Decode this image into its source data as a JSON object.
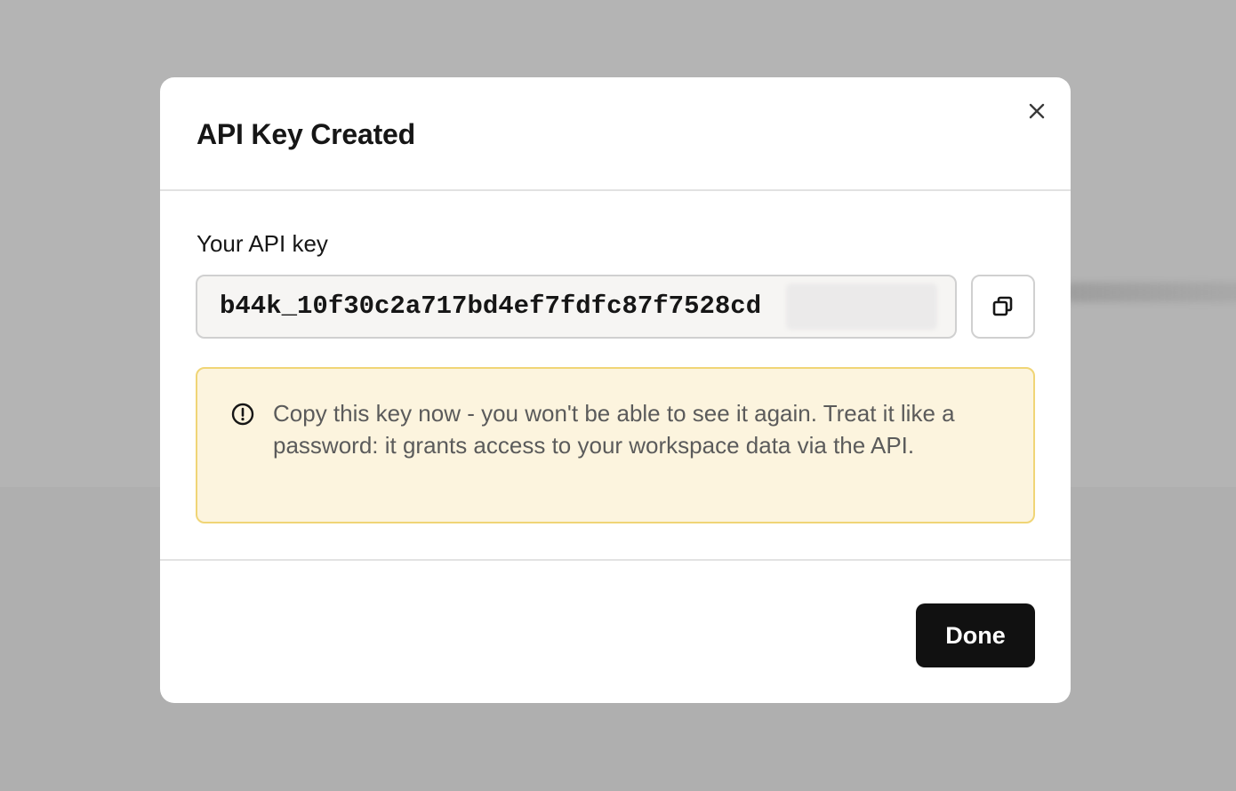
{
  "dialog": {
    "title": "API Key Created",
    "close_icon": "close-icon",
    "field_label": "Your API key",
    "api_key_visible": "b44k_10f30c2a717bd4ef7fdfc87f7528cd",
    "copy_icon": "copy-icon",
    "warning_icon": "alert-circle-icon",
    "warning_text": "Copy this key now - you won't be able to see it again. Treat it like a password: it grants access to your workspace data via the API.",
    "done_label": "Done"
  },
  "colors": {
    "backdrop": "#b4b4b4",
    "warning_bg": "#fcf4de",
    "warning_border": "#f0d576",
    "primary_button": "#111111"
  }
}
